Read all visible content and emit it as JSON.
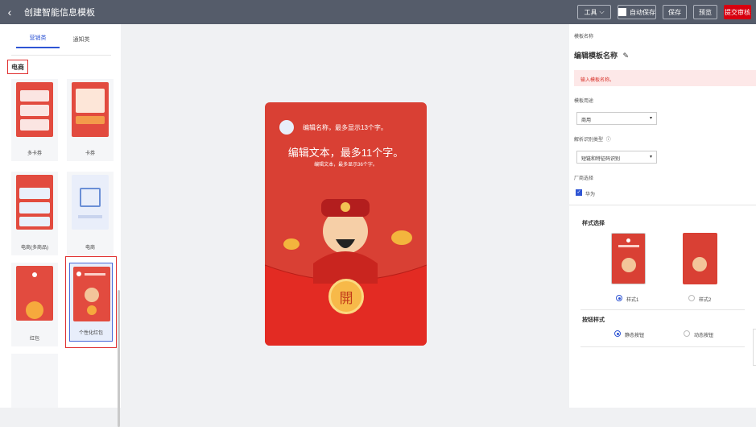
{
  "topbar": {
    "back_icon": "chevron-left-icon",
    "title": "创建智能信息模板",
    "tools_label": "工具",
    "autosave_label": "自动保存",
    "save_label": "保存",
    "preview_label": "预览",
    "submit_label": "提交审核"
  },
  "left": {
    "tabs": [
      "营销类",
      "通知类"
    ],
    "category": "电商",
    "cards": [
      {
        "label": "多卡券"
      },
      {
        "label": "卡券"
      },
      {
        "label": "电商(多商品)"
      },
      {
        "label": "电商"
      },
      {
        "label": "红包"
      },
      {
        "label": "个性化红包"
      }
    ]
  },
  "preview": {
    "title": "编辑名称，最多显示13个字。",
    "big_text": "编辑文本，最多11个字。",
    "small_text": "编辑文本，最多显示36个字。",
    "open_char": "開"
  },
  "right": {
    "name_label": "模板名称",
    "name_value": "编辑模板名称",
    "name_error": "输入模板名称。",
    "usage_label": "模板用途",
    "usage_value": "商用",
    "parse_label": "解析识别类型",
    "parse_value": "短链和特征码识别",
    "vendor_label": "厂商选择",
    "vendor_option": "华为",
    "style_section": "样式选择",
    "styles": [
      "样式1",
      "样式2"
    ],
    "button_section": "按钮样式",
    "button_options": [
      "静态按钮",
      "动态按钮"
    ]
  },
  "colors": {
    "topbar": "#555c6a",
    "accent": "#2f55d4",
    "submit": "#d7000f",
    "envelope": "#d94034"
  }
}
